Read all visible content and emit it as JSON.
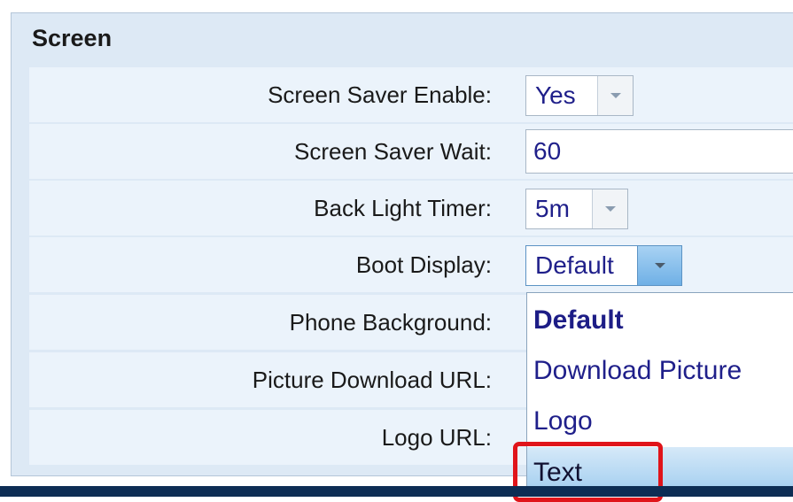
{
  "section": {
    "title": "Screen"
  },
  "fields": {
    "screen_saver_enable": {
      "label": "Screen Saver Enable:",
      "value": "Yes"
    },
    "screen_saver_wait": {
      "label": "Screen Saver Wait:",
      "value": "60"
    },
    "back_light_timer": {
      "label": "Back Light Timer:",
      "value": "5m"
    },
    "boot_display": {
      "label": "Boot Display:",
      "value": "Default"
    },
    "phone_background": {
      "label": "Phone Background:"
    },
    "picture_download_url": {
      "label": "Picture Download URL:"
    },
    "logo_url": {
      "label": "Logo URL:"
    }
  },
  "dropdown": {
    "options": [
      "Default",
      "Download Picture",
      "Logo",
      "Text"
    ],
    "selected": "Default",
    "hovered": "Text"
  },
  "colors": {
    "panel_bg": "#dde9f5",
    "row_bg": "#ebf3fb",
    "value_text": "#1f1f8a",
    "highlight_red": "#e0141a",
    "footer": "#0d2d54"
  },
  "icons": {
    "select_arrow": "chevron-down-icon"
  }
}
